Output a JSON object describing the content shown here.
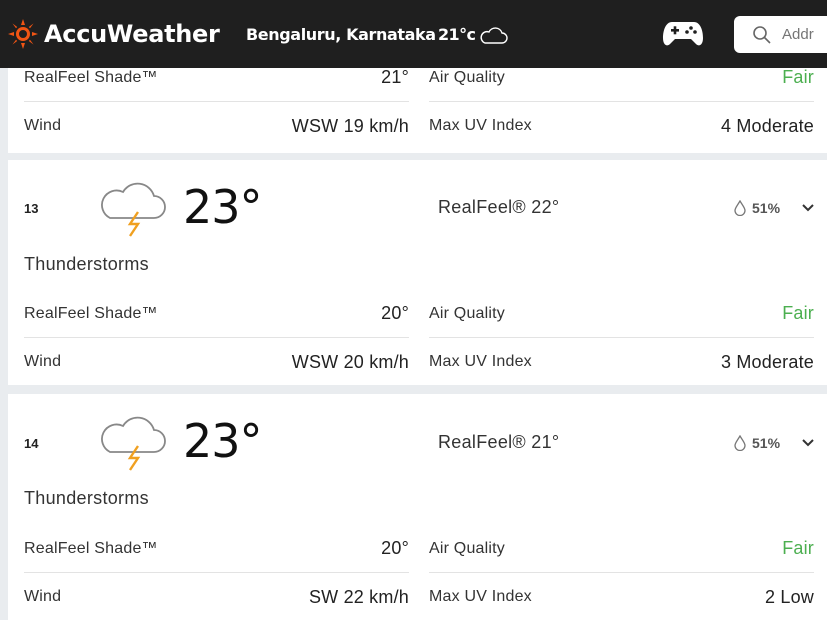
{
  "header": {
    "brand": "AccuWeather",
    "location": "Bengaluru, Karnataka",
    "temp": "21°c",
    "search_placeholder": "Addr",
    "icons": {
      "logo": "sun-logo-icon",
      "cloud": "cloud-icon",
      "game": "gamepad-icon",
      "search": "search-icon"
    },
    "brand_color": "#f05514"
  },
  "partial_card": {
    "realfeel_shade_label": "RealFeel Shade™",
    "realfeel_shade_value": "21°",
    "air_quality_label": "Air Quality",
    "air_quality_value": "Fair",
    "wind_label": "Wind",
    "wind_value": "WSW 19 km/h",
    "uv_label": "Max UV Index",
    "uv_value": "4 Moderate"
  },
  "hours": [
    {
      "hour": "13",
      "temp": "23°",
      "realfeel": "RealFeel® 22°",
      "precip": "51%",
      "phrase": "Thunderstorms",
      "realfeel_shade_label": "RealFeel Shade™",
      "realfeel_shade_value": "20°",
      "air_quality_label": "Air Quality",
      "air_quality_value": "Fair",
      "wind_label": "Wind",
      "wind_value": "WSW 20 km/h",
      "uv_label": "Max UV Index",
      "uv_value": "3 Moderate"
    },
    {
      "hour": "14",
      "temp": "23°",
      "realfeel": "RealFeel® 21°",
      "precip": "51%",
      "phrase": "Thunderstorms",
      "realfeel_shade_label": "RealFeel Shade™",
      "realfeel_shade_value": "20°",
      "air_quality_label": "Air Quality",
      "air_quality_value": "Fair",
      "wind_label": "Wind",
      "wind_value": "SW 22 km/h",
      "uv_label": "Max UV Index",
      "uv_value": "2 Low"
    }
  ],
  "colors": {
    "fair": "#4caf50",
    "lightning": "#f0a020"
  }
}
